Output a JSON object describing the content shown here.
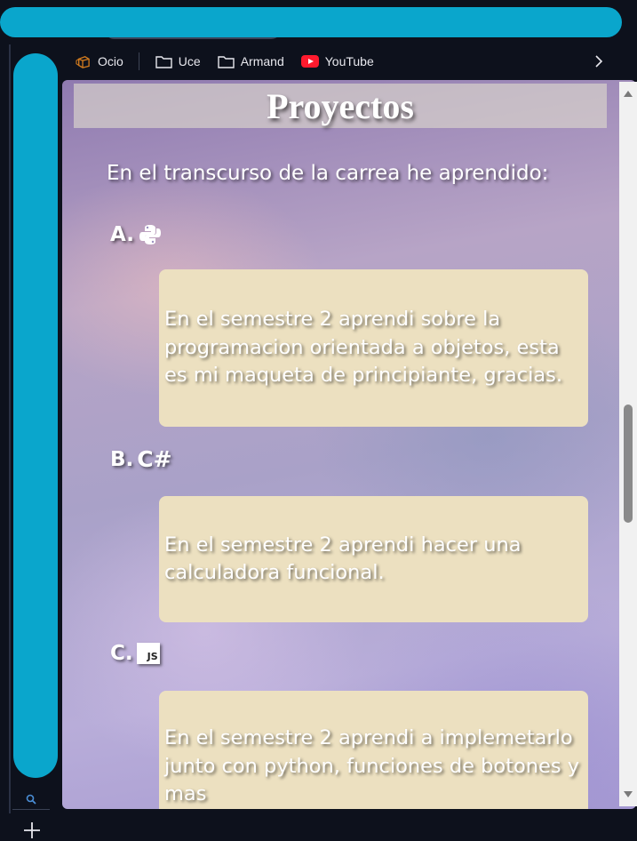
{
  "bookmarks": [
    {
      "label": "Ocio",
      "icon": "box-icon"
    },
    {
      "label": "Uce",
      "icon": "folder-icon"
    },
    {
      "label": "Armand",
      "icon": "folder-icon"
    },
    {
      "label": "YouTube",
      "icon": "youtube-icon"
    }
  ],
  "page": {
    "title": "Proyectos",
    "intro": "En el transcurso de la carrea he aprendido:",
    "items": [
      {
        "marker": "A.",
        "icon": "python-icon",
        "text": "En el semestre 2 aprendi sobre la programacion orientada a objetos, esta es mi maqueta de principiante, gracias."
      },
      {
        "marker": "B.",
        "icon_text": "C#",
        "text": "En el semestre 2 aprendi hacer una calculadora funcional."
      },
      {
        "marker": "C.",
        "icon_text": "JS",
        "text": "En el semestre 2 aprendi a implemetarlo junto con python, funciones de botones y mas"
      }
    ]
  },
  "colors": {
    "card_bg": "#ece0c0",
    "annotation_scribble": "#0aa6cc",
    "youtube_red": "#ff1a2e"
  }
}
